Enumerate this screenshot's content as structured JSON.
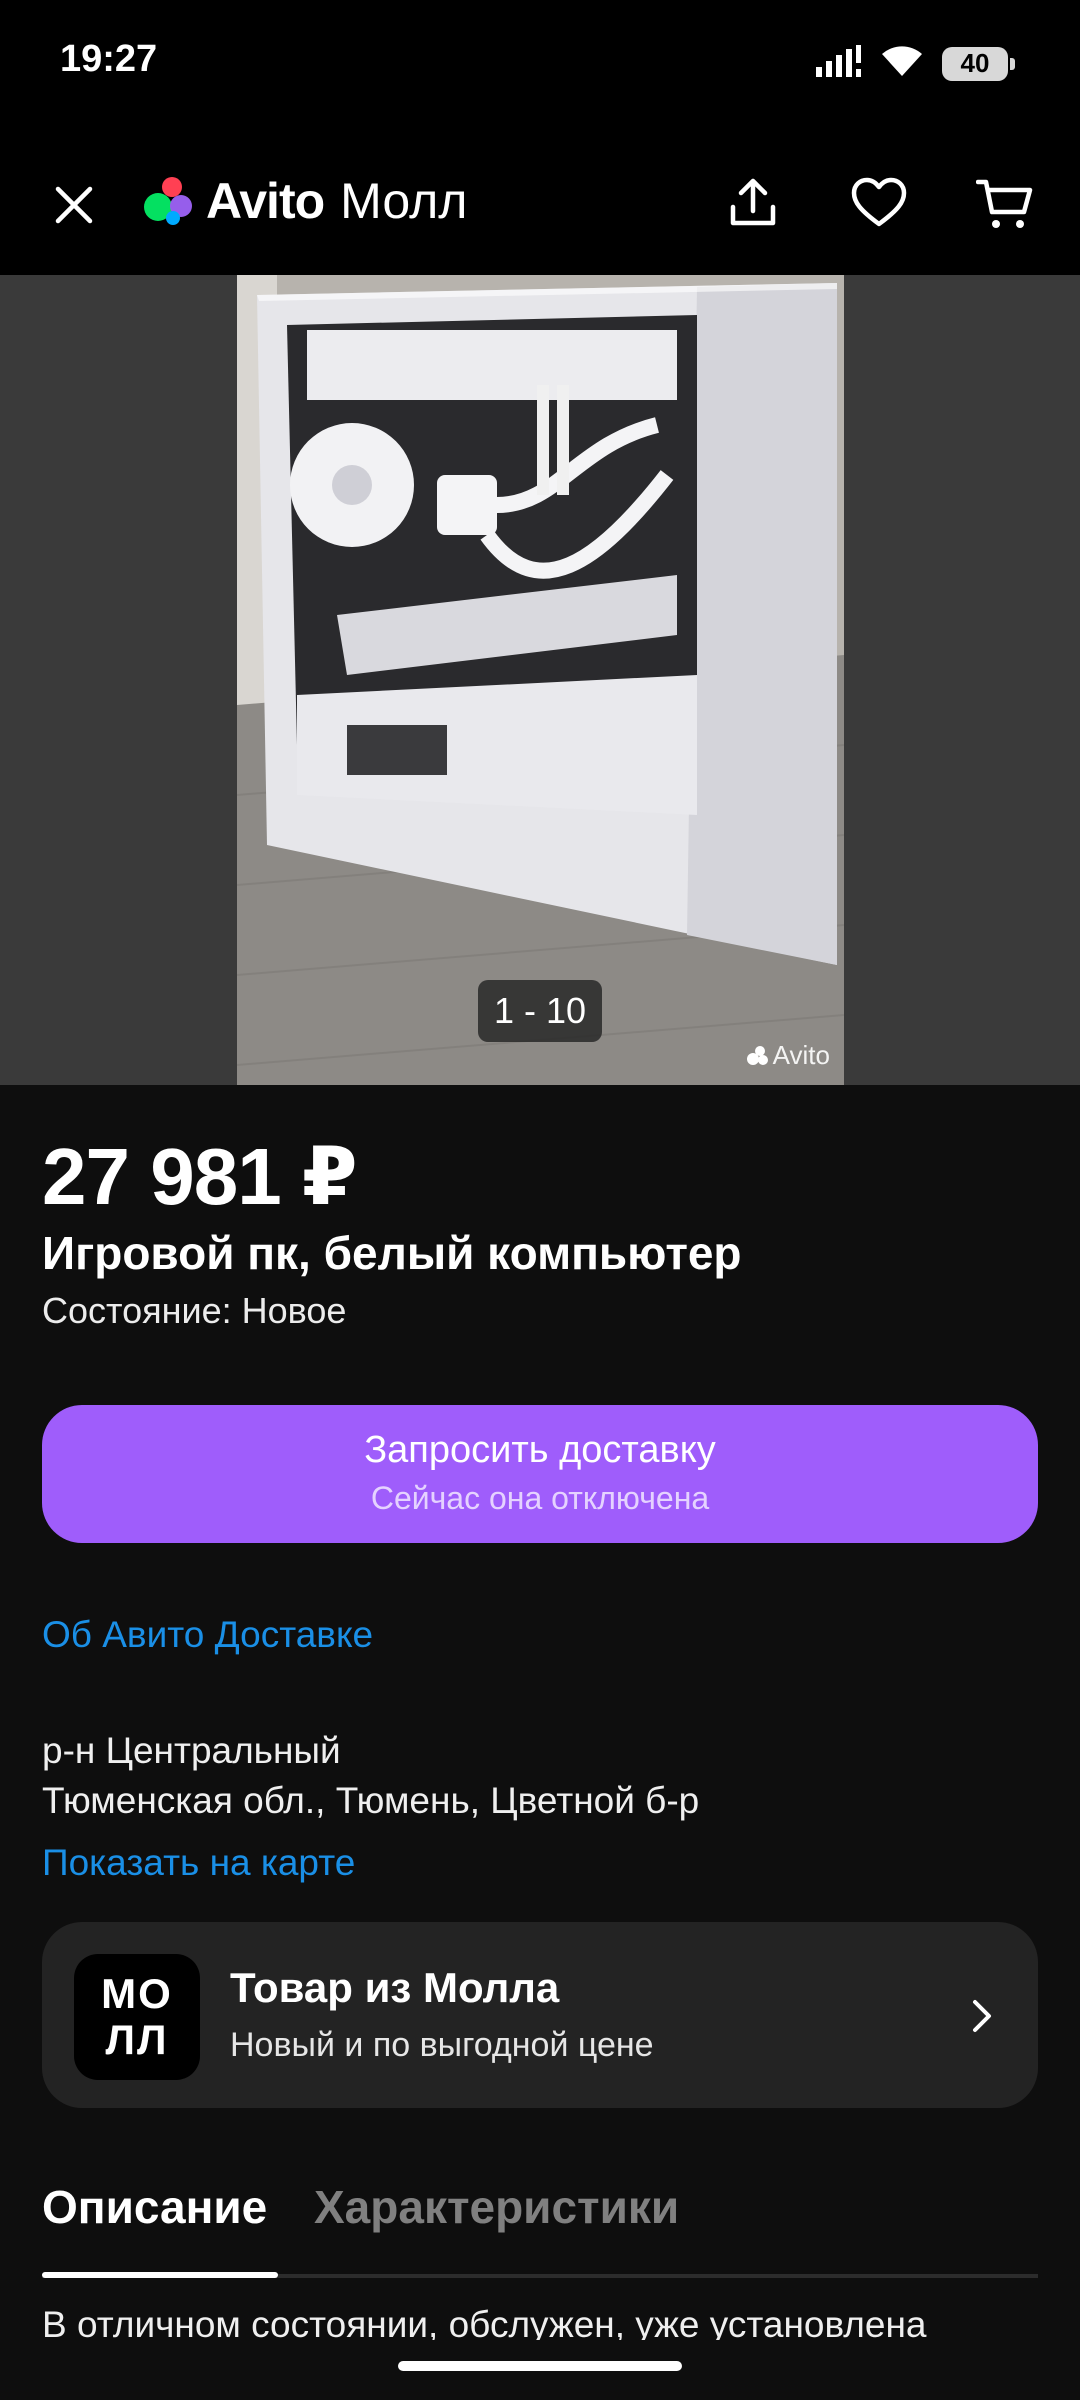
{
  "status_bar": {
    "time": "19:27",
    "battery": "40",
    "icons": [
      "signal-icon",
      "wifi-icon",
      "battery-icon"
    ]
  },
  "app_bar": {
    "logo_avito": "Avito",
    "logo_mall": "Молл",
    "icons": [
      "close-icon",
      "share-icon",
      "heart-icon",
      "cart-icon"
    ]
  },
  "gallery": {
    "counter": "1 - 10",
    "watermark": "Avito"
  },
  "listing": {
    "price": "27 981 ₽",
    "title": "Игровой пк, белый компьютер",
    "condition": "Состояние: Новое"
  },
  "delivery": {
    "button_label": "Запросить доставку",
    "button_sublabel": "Сейчас она отключена",
    "about_link": "Об Авито Доставке"
  },
  "location": {
    "district": "р-н Центральный",
    "address": "Тюменская обл., Тюмень, Цветной б-р",
    "map_link": "Показать на карте"
  },
  "mall_card": {
    "logo_line1": "МО",
    "logo_line2": "ЛЛ",
    "title": "Товар из Молла",
    "subtitle": "Новый и по выгодной цене"
  },
  "tabs": {
    "description": "Описание",
    "characteristics": "Характеристики"
  },
  "description_preview": "В отличном состоянии, обслужен, уже установлена",
  "colors": {
    "accent_purple": "#9f5dfb",
    "link_blue": "#1a8fe6",
    "background": "#0e0e0e",
    "card": "#232323"
  }
}
